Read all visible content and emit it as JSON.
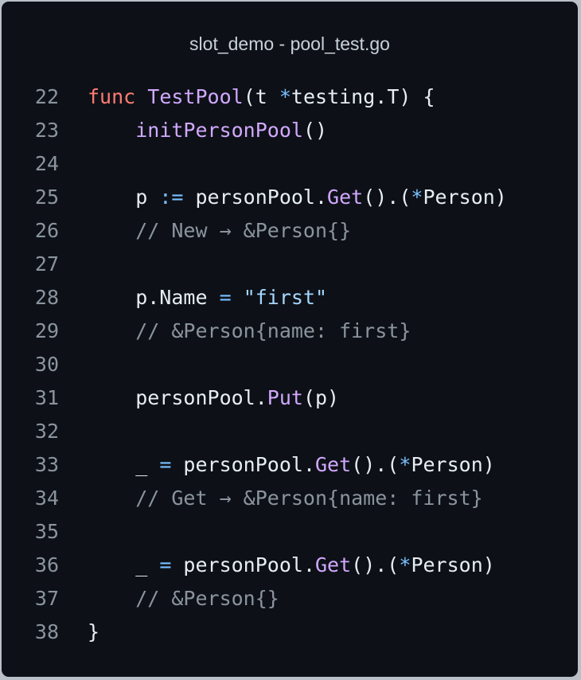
{
  "window": {
    "title": "slot_demo - pool_test.go"
  },
  "colors": {
    "background": "#0d1117",
    "keyword": "#ff7b72",
    "function": "#d2a8ff",
    "operator": "#79c0ff",
    "string": "#a5d6ff",
    "comment": "#8b949e",
    "plain": "#e6edf3"
  },
  "editor": {
    "lines": [
      {
        "n": "22",
        "tokens": [
          [
            "kw",
            "func"
          ],
          [
            "pl",
            " "
          ],
          [
            "fn",
            "TestPool"
          ],
          [
            "pl",
            "(t "
          ],
          [
            "op",
            "*"
          ],
          [
            "pl",
            "testing.T) {"
          ]
        ]
      },
      {
        "n": "23",
        "tokens": [
          [
            "pl",
            "    "
          ],
          [
            "fn",
            "initPersonPool"
          ],
          [
            "pl",
            "()"
          ]
        ]
      },
      {
        "n": "24",
        "tokens": []
      },
      {
        "n": "25",
        "tokens": [
          [
            "pl",
            "    p "
          ],
          [
            "op",
            ":="
          ],
          [
            "pl",
            " personPool."
          ],
          [
            "fn",
            "Get"
          ],
          [
            "pl",
            "().("
          ],
          [
            "op",
            "*"
          ],
          [
            "pl",
            "Person)"
          ]
        ]
      },
      {
        "n": "26",
        "tokens": [
          [
            "cm",
            "    // New → &Person{}"
          ]
        ]
      },
      {
        "n": "27",
        "tokens": []
      },
      {
        "n": "28",
        "tokens": [
          [
            "pl",
            "    p.Name "
          ],
          [
            "op",
            "="
          ],
          [
            "pl",
            " "
          ],
          [
            "str",
            "\"first\""
          ]
        ]
      },
      {
        "n": "29",
        "tokens": [
          [
            "cm",
            "    // &Person{name: first}"
          ]
        ]
      },
      {
        "n": "30",
        "tokens": []
      },
      {
        "n": "31",
        "tokens": [
          [
            "pl",
            "    personPool."
          ],
          [
            "fn",
            "Put"
          ],
          [
            "pl",
            "(p)"
          ]
        ]
      },
      {
        "n": "32",
        "tokens": []
      },
      {
        "n": "33",
        "tokens": [
          [
            "pl",
            "    _ "
          ],
          [
            "op",
            "="
          ],
          [
            "pl",
            " personPool."
          ],
          [
            "fn",
            "Get"
          ],
          [
            "pl",
            "().("
          ],
          [
            "op",
            "*"
          ],
          [
            "pl",
            "Person)"
          ]
        ]
      },
      {
        "n": "34",
        "tokens": [
          [
            "cm",
            "    // Get → &Person{name: first}"
          ]
        ]
      },
      {
        "n": "35",
        "tokens": []
      },
      {
        "n": "36",
        "tokens": [
          [
            "pl",
            "    _ "
          ],
          [
            "op",
            "="
          ],
          [
            "pl",
            " personPool."
          ],
          [
            "fn",
            "Get"
          ],
          [
            "pl",
            "().("
          ],
          [
            "op",
            "*"
          ],
          [
            "pl",
            "Person)"
          ]
        ]
      },
      {
        "n": "37",
        "tokens": [
          [
            "cm",
            "    // &Person{}"
          ]
        ]
      },
      {
        "n": "38",
        "tokens": [
          [
            "pl",
            "}"
          ]
        ]
      }
    ]
  }
}
